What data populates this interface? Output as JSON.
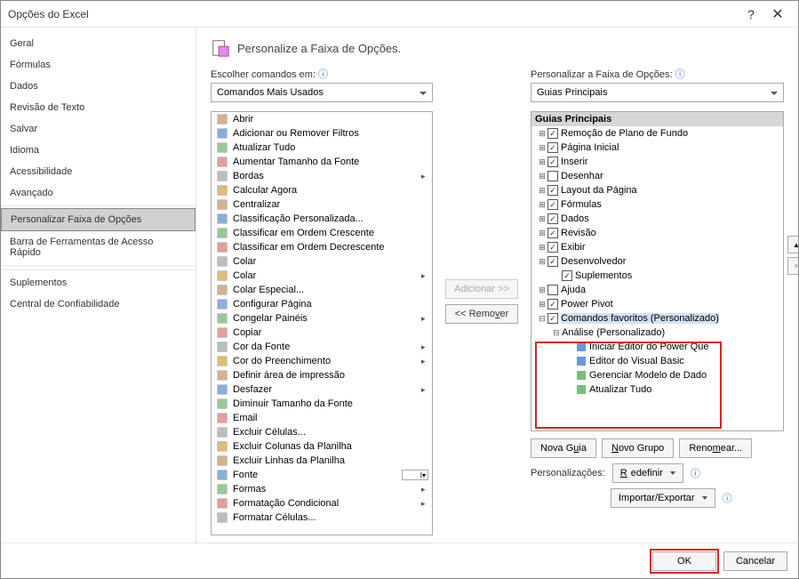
{
  "window": {
    "title": "Opções do Excel",
    "help": "?",
    "close": "✕"
  },
  "sidebar": {
    "items": [
      "Geral",
      "Fórmulas",
      "Dados",
      "Revisão de Texto",
      "Salvar",
      "Idioma",
      "Acessibilidade",
      "Avançado",
      "Personalizar Faixa de Opções",
      "Barra de Ferramentas de Acesso Rápido",
      "Suplementos",
      "Central de Confiabilidade"
    ],
    "selected_index": 8
  },
  "header": {
    "text": "Personalize a Faixa de Opções."
  },
  "left": {
    "label": "Escolher comandos em:",
    "combo": "Comandos Mais Usados",
    "commands": [
      {
        "t": "Abrir"
      },
      {
        "t": "Adicionar ou Remover Filtros"
      },
      {
        "t": "Atualizar Tudo"
      },
      {
        "t": "Aumentar Tamanho da Fonte"
      },
      {
        "t": "Bordas",
        "sub": true
      },
      {
        "t": "Calcular Agora"
      },
      {
        "t": "Centralizar"
      },
      {
        "t": "Classificação Personalizada..."
      },
      {
        "t": "Classificar em Ordem Crescente"
      },
      {
        "t": "Classificar em Ordem Decrescente"
      },
      {
        "t": "Colar"
      },
      {
        "t": "Colar",
        "sub": true
      },
      {
        "t": "Colar Especial..."
      },
      {
        "t": "Configurar Página"
      },
      {
        "t": "Congelar Painéis",
        "sub": true
      },
      {
        "t": "Copiar"
      },
      {
        "t": "Cor da Fonte",
        "sub": true
      },
      {
        "t": "Cor do Preenchimento",
        "sub": true
      },
      {
        "t": "Definir área de impressão"
      },
      {
        "t": "Desfazer",
        "sub": true
      },
      {
        "t": "Diminuir Tamanho da Fonte"
      },
      {
        "t": "Email"
      },
      {
        "t": "Excluir Células..."
      },
      {
        "t": "Excluir Colunas da Planilha"
      },
      {
        "t": "Excluir Linhas da Planilha"
      },
      {
        "t": "Fonte",
        "field": true
      },
      {
        "t": "Formas",
        "sub": true
      },
      {
        "t": "Formatação Condicional",
        "sub": true
      },
      {
        "t": "Formatar Células..."
      }
    ]
  },
  "mid": {
    "add": "Adicionar >>",
    "remove": "<< Remover"
  },
  "right": {
    "label": "Personalizar a Faixa de Opções:",
    "combo": "Guias Principais",
    "header": "Guias Principais",
    "nodes": [
      {
        "lvl": 1,
        "cb": true,
        "t": "Remoção de Plano de Fundo",
        "exp": "+"
      },
      {
        "lvl": 1,
        "cb": true,
        "t": "Página Inicial",
        "exp": "+"
      },
      {
        "lvl": 1,
        "cb": true,
        "t": "Inserir",
        "exp": "+"
      },
      {
        "lvl": 1,
        "cb": false,
        "t": "Desenhar",
        "exp": "+"
      },
      {
        "lvl": 1,
        "cb": true,
        "t": "Layout da Página",
        "exp": "+"
      },
      {
        "lvl": 1,
        "cb": true,
        "t": "Fórmulas",
        "exp": "+"
      },
      {
        "lvl": 1,
        "cb": true,
        "t": "Dados",
        "exp": "+"
      },
      {
        "lvl": 1,
        "cb": true,
        "t": "Revisão",
        "exp": "+"
      },
      {
        "lvl": 1,
        "cb": true,
        "t": "Exibir",
        "exp": "+"
      },
      {
        "lvl": 1,
        "cb": true,
        "t": "Desenvolvedor",
        "exp": "+"
      },
      {
        "lvl": 2,
        "cb": true,
        "t": "Suplementos",
        "exp": ""
      },
      {
        "lvl": 1,
        "cb": false,
        "t": "Ajuda",
        "exp": "+"
      },
      {
        "lvl": 1,
        "cb": true,
        "t": "Power Pivot",
        "exp": "+"
      },
      {
        "lvl": 1,
        "cb": true,
        "t": "Comandos favoritos (Personalizado)",
        "exp": "−",
        "hl": true
      },
      {
        "lvl": 2,
        "cb": null,
        "t": "Análise (Personalizado)",
        "exp": "−"
      },
      {
        "lvl": 3,
        "cb": null,
        "t": "Iniciar Editor do Power Que",
        "ic": "pq"
      },
      {
        "lvl": 3,
        "cb": null,
        "t": "Editor do Visual Basic",
        "ic": "vb"
      },
      {
        "lvl": 3,
        "cb": null,
        "t": "Gerenciar Modelo de Dado",
        "ic": "dm"
      },
      {
        "lvl": 3,
        "cb": null,
        "t": "Atualizar Tudo",
        "ic": "rf"
      }
    ],
    "buttons": {
      "newTab": "Nova Guia",
      "newGroup": "Novo Grupo",
      "rename": "Renomear..."
    },
    "pers": {
      "label": "Personalizações:",
      "reset": "Redefinir",
      "import": "Importar/Exportar"
    }
  },
  "footer": {
    "ok": "OK",
    "cancel": "Cancelar"
  }
}
